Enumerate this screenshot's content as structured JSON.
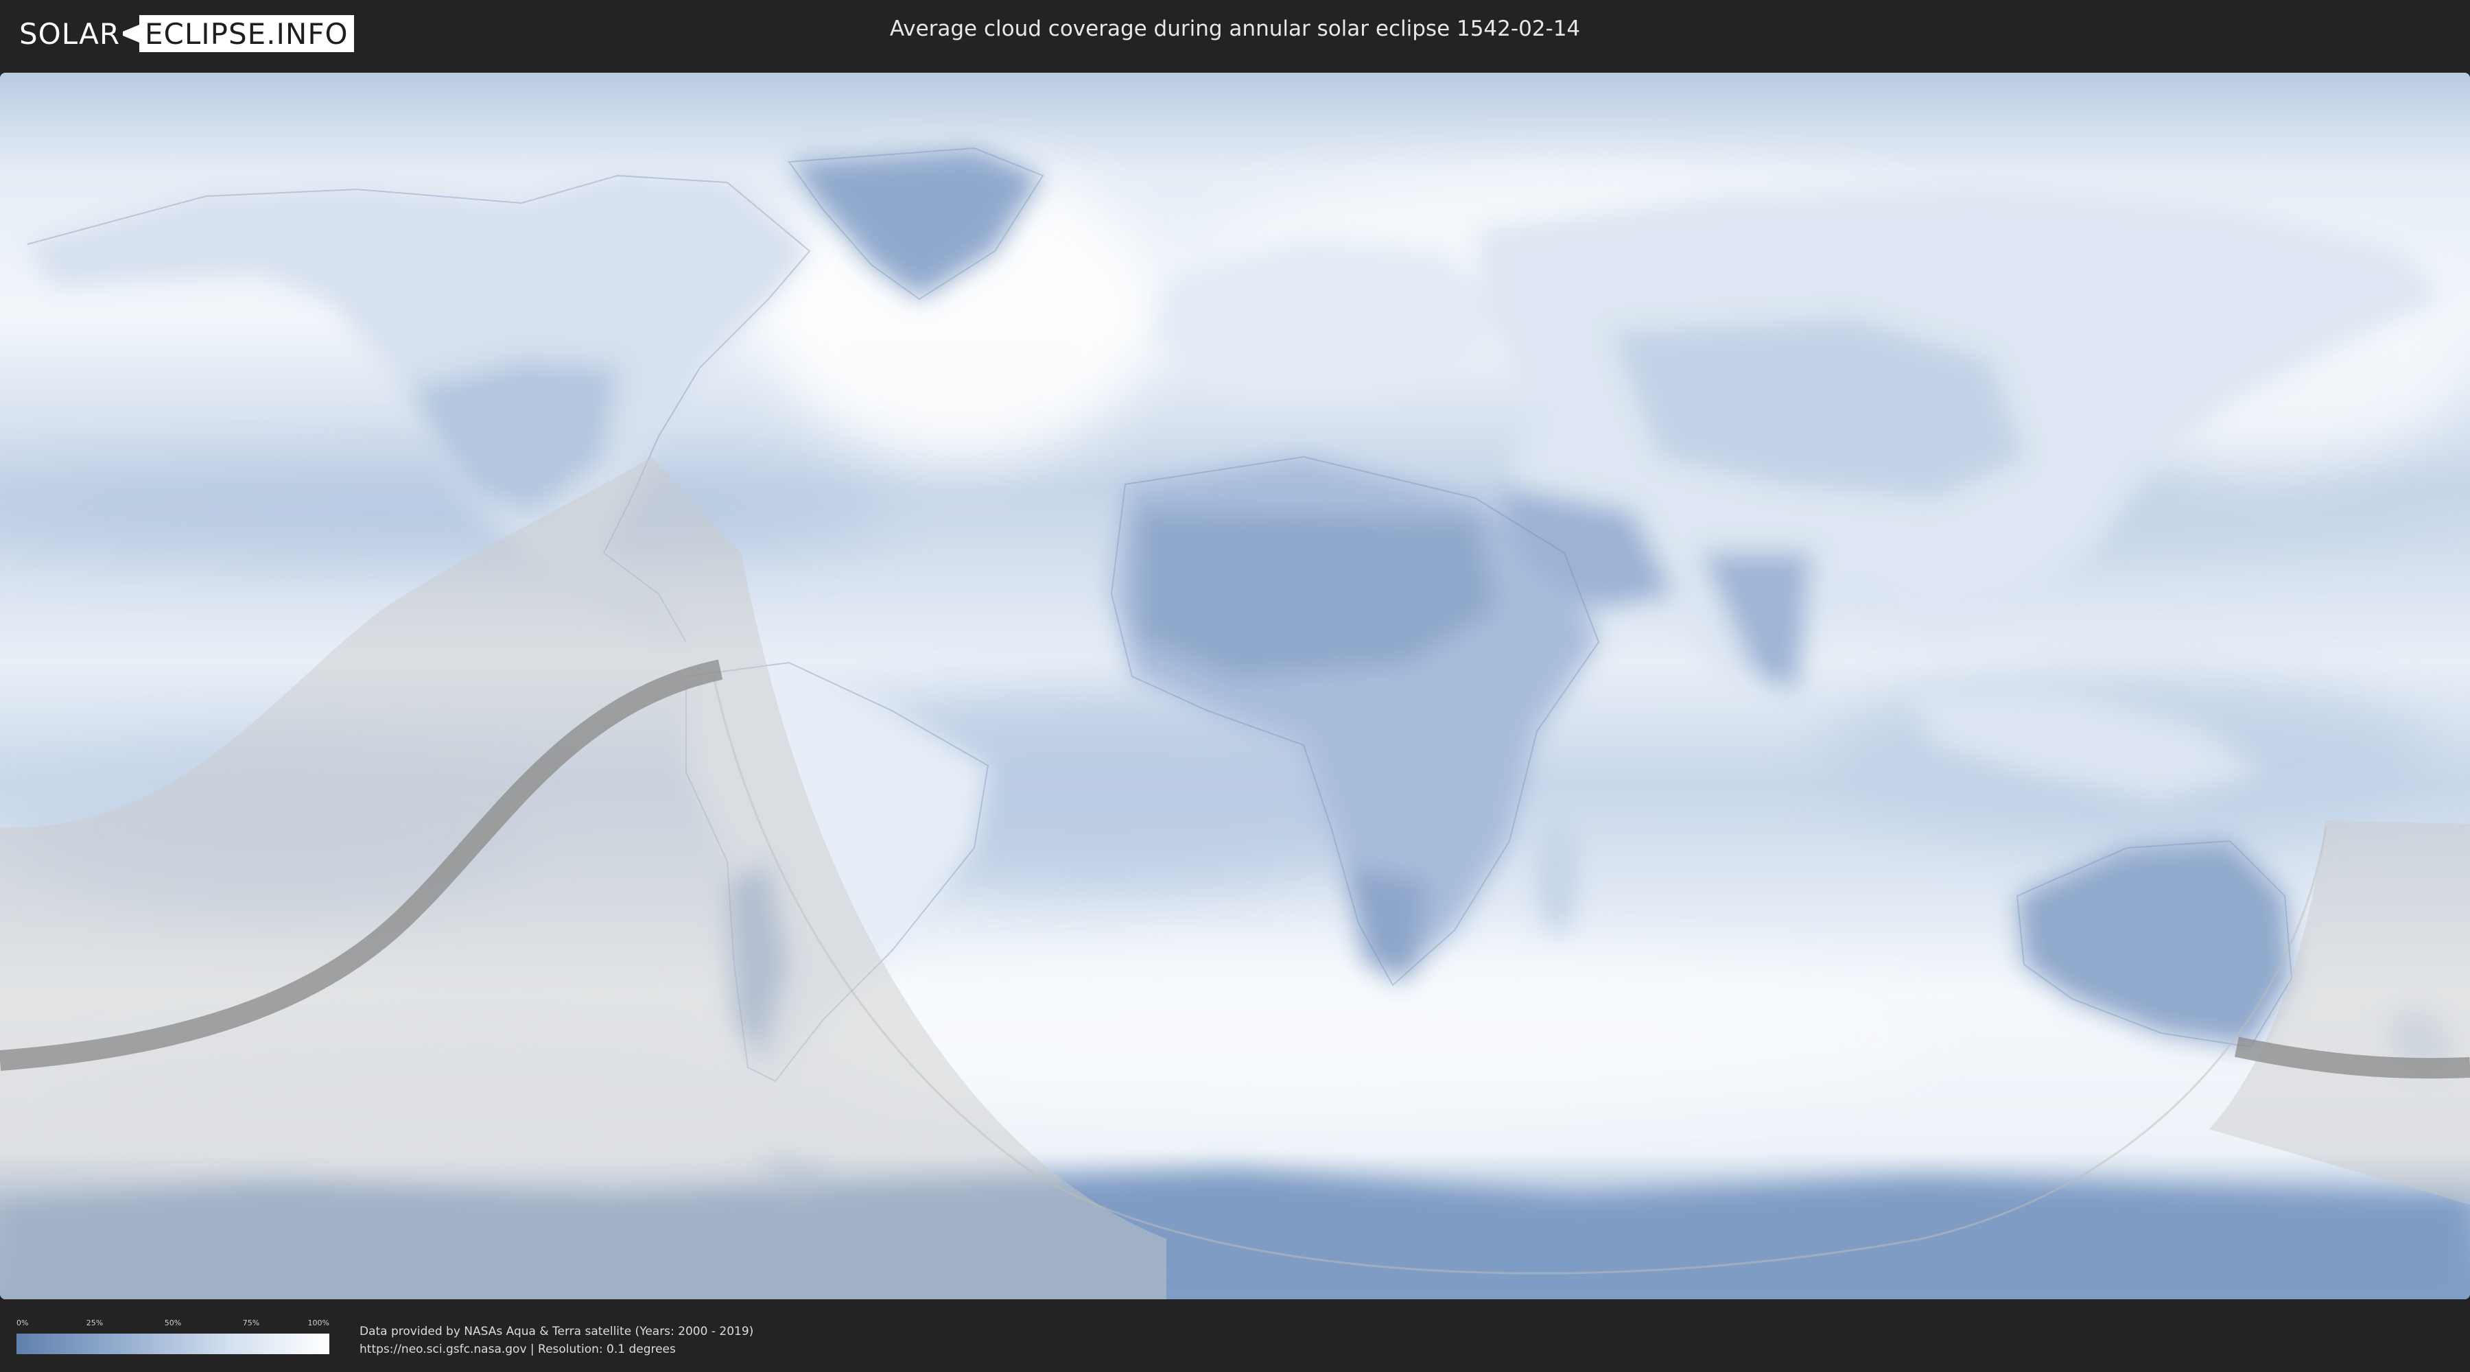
{
  "header": {
    "logo_part1": "SOLAR",
    "logo_part2": "ECLIPSE.INFO",
    "title": "Average cloud coverage during annular solar eclipse 1542-02-14"
  },
  "legend": {
    "ticks": [
      "0%",
      "25%",
      "50%",
      "75%",
      "100%"
    ],
    "colors": [
      "#5f7fae",
      "#97b0d1",
      "#d6e2f0",
      "#ffffff"
    ]
  },
  "credits": {
    "line1": "Data provided by NASAs Aqua & Terra satellite (Years: 2000 - 2019)",
    "line2": "https://neo.sci.gsfc.nasa.gov | Resolution: 0.1 degrees"
  },
  "map": {
    "cloud_high_color": "#ffffff",
    "cloud_low_color": "#6d8bb8",
    "eclipse_overlay_color": "#c9c9c9",
    "eclipse_path_color": "#8a8a8a"
  }
}
